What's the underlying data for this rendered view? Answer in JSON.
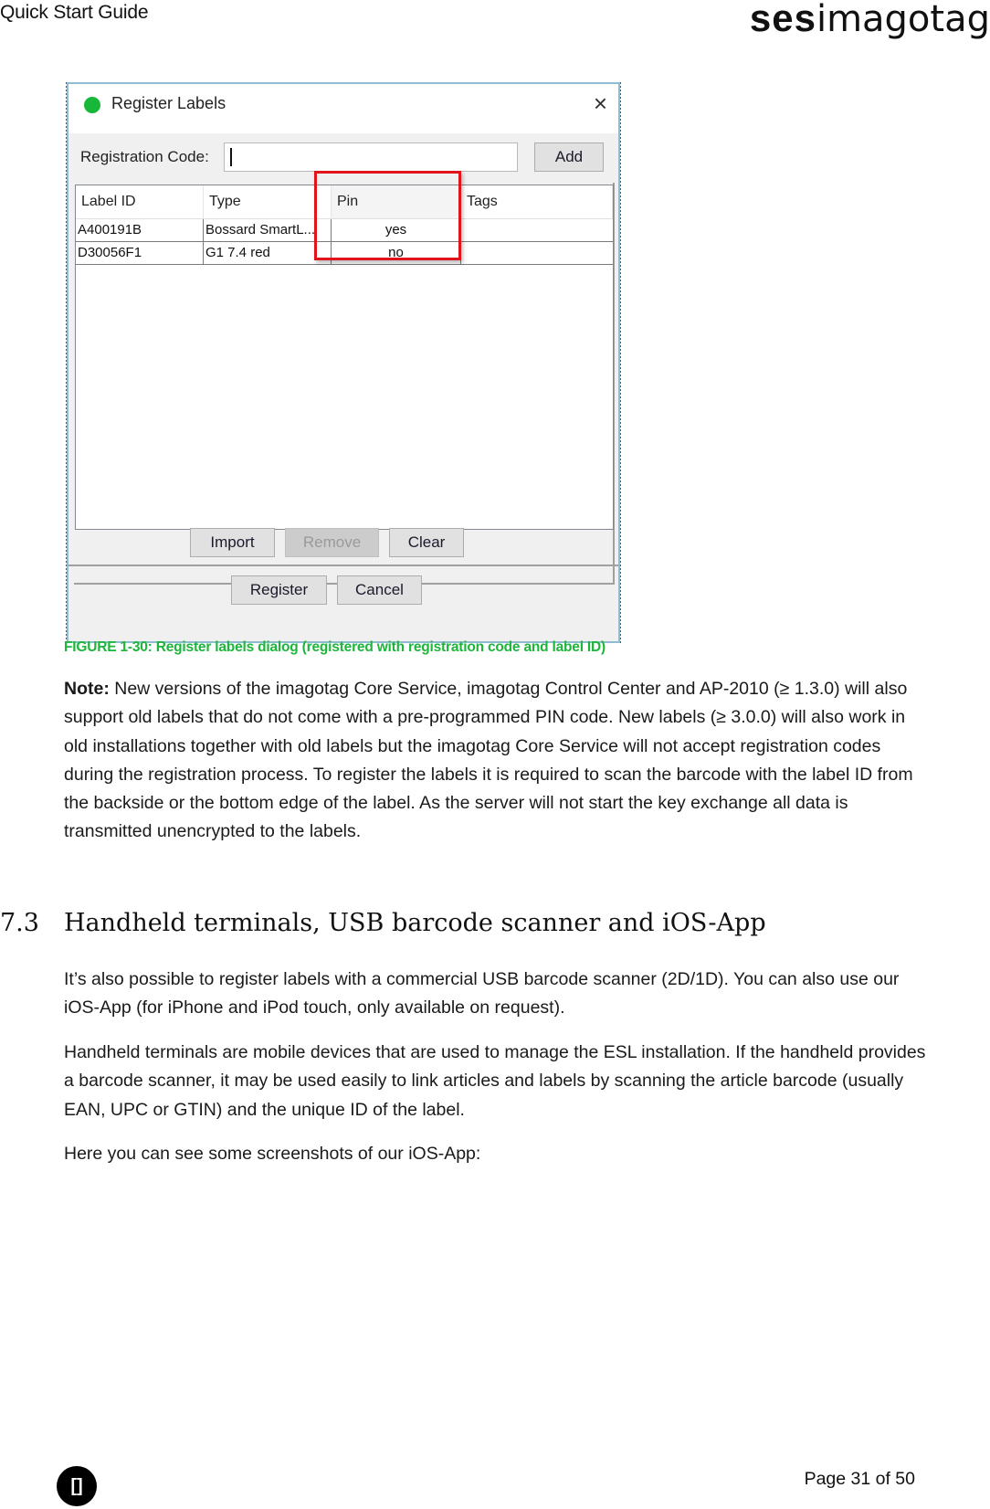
{
  "header": {
    "doc_title": "Quick Start Guide",
    "logo_bold": "ses",
    "logo_light": "imagotag"
  },
  "dialog": {
    "title": "Register Labels",
    "status_dot_color": "#17b83a",
    "close_icon": "×",
    "registration_label": "Registration Code:",
    "registration_value": "",
    "add_label": "Add",
    "table": {
      "columns": [
        "Label ID",
        "Type",
        "Pin",
        "Tags"
      ],
      "rows": [
        {
          "label_id": "A400191B",
          "type": "Bossard SmartL...",
          "pin": "yes",
          "tags": ""
        },
        {
          "label_id": "D30056F1",
          "type": "G1 7.4 red",
          "pin": "no",
          "tags": ""
        }
      ]
    },
    "highlight_color": "#e0141a",
    "buttons": {
      "import": "Import",
      "remove": "Remove",
      "clear": "Clear",
      "register": "Register",
      "cancel": "Cancel"
    }
  },
  "caption": "FIGURE 1-30: Register labels dialog (registered with registration code and label ID)",
  "note": {
    "lead": "Note:",
    "text": " New versions of the imagotag Core Service, imagotag Control Center and AP-2010 (≥ 1.3.0) will also support old labels that do not come with a pre-programmed PIN code. New labels (≥ 3.0.0) will also work in old installations together with old labels but the imagotag Core Service will not accept registration codes during the registration process. To register the labels it is required to scan the barcode with the label ID from the backside or the bottom edge of the label. As the server will not start the key exchange all data is transmitted unencrypted to the labels."
  },
  "section": {
    "number": "7.3",
    "title": "Handheld terminals, USB barcode scanner and iOS-App"
  },
  "paragraphs": [
    "It’s also possible to register labels with a commercial USB barcode scanner (2D/1D). You can also use our iOS-App (for iPhone and iPod touch, only available on request).",
    "Handheld terminals are mobile devices that are used to manage the ESL installation. If the handheld provides a barcode scanner, it may be used easily to link articles and labels by scanning the article barcode (usually EAN, UPC or GTIN) and the unique ID of the label.",
    "Here you can see some screenshots of our iOS-App:"
  ],
  "footer": {
    "badge_icon": "[]",
    "page": "Page 31 of 50"
  },
  "colors": {
    "caption_green": "#1db53a",
    "dialog_border": "#8fbcd0"
  }
}
